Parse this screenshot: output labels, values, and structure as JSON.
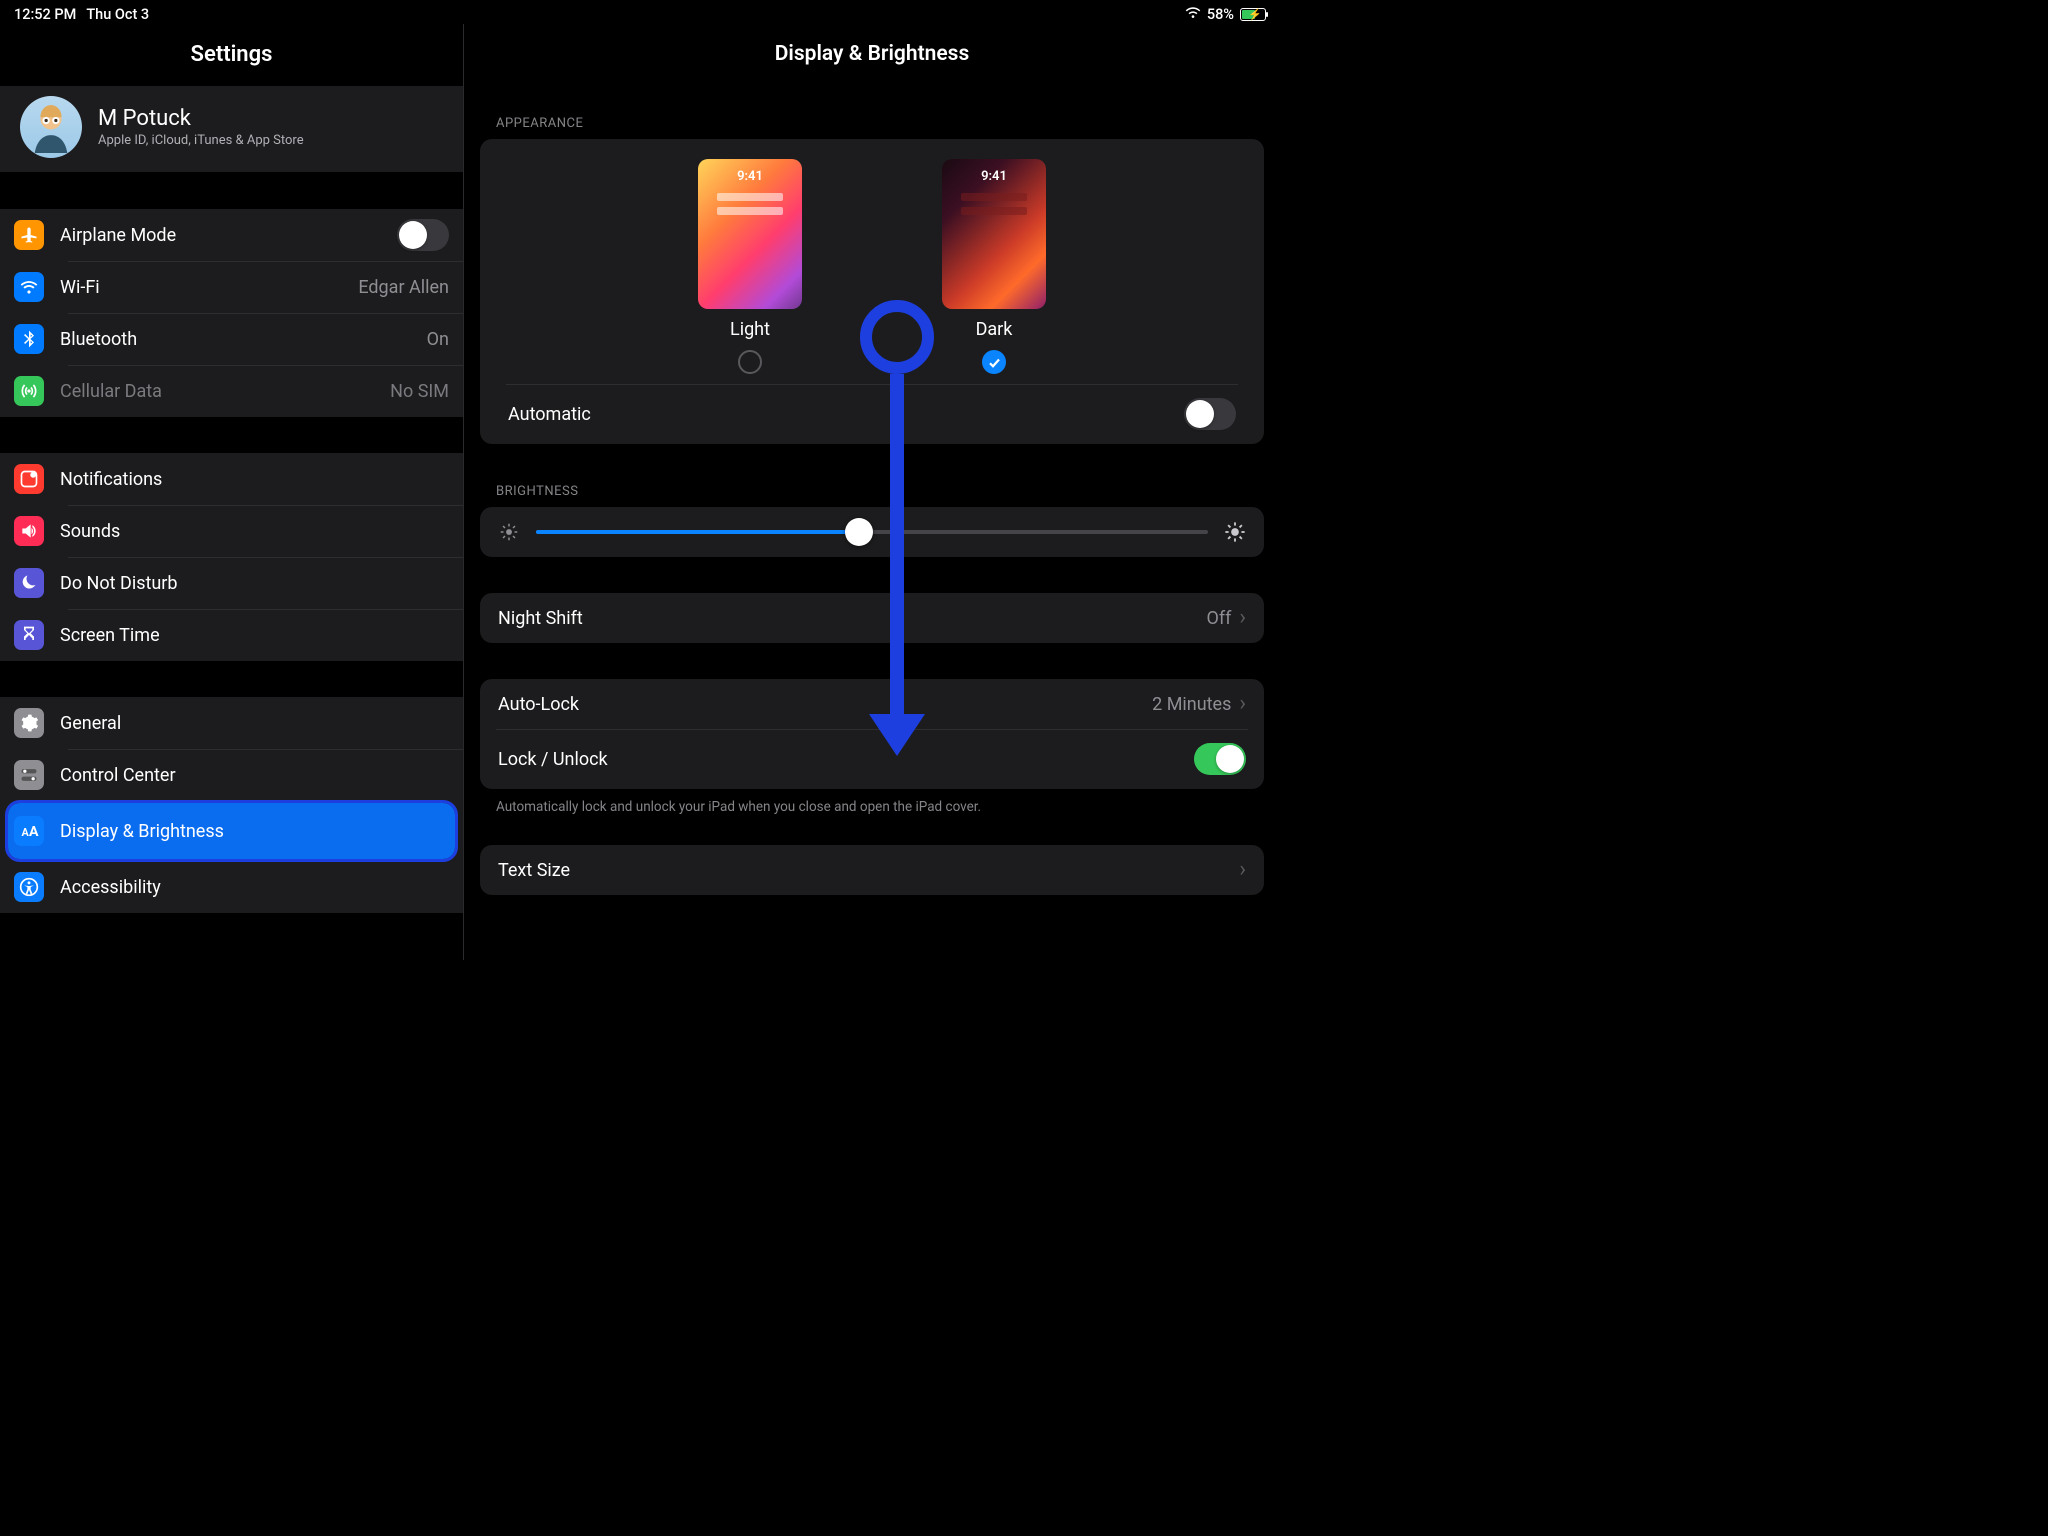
{
  "status": {
    "time": "12:52 PM",
    "date": "Thu Oct 3",
    "battery_pct": "58%"
  },
  "sidebar": {
    "title": "Settings",
    "profile": {
      "name": "M Potuck",
      "sub": "Apple ID, iCloud, iTunes & App Store"
    },
    "airplane": "Airplane Mode",
    "wifi": {
      "label": "Wi-Fi",
      "value": "Edgar Allen"
    },
    "bluetooth": {
      "label": "Bluetooth",
      "value": "On"
    },
    "cellular": {
      "label": "Cellular Data",
      "value": "No SIM"
    },
    "notifications": "Notifications",
    "sounds": "Sounds",
    "dnd": "Do Not Disturb",
    "screentime": "Screen Time",
    "general": "General",
    "controlcenter": "Control Center",
    "display": "Display & Brightness",
    "accessibility": "Accessibility"
  },
  "detail": {
    "title": "Display & Brightness",
    "appearance_header": "APPEARANCE",
    "theme_time": "9:41",
    "light": "Light",
    "dark": "Dark",
    "automatic": "Automatic",
    "brightness_header": "BRIGHTNESS",
    "nightshift": {
      "label": "Night Shift",
      "value": "Off"
    },
    "autolock": {
      "label": "Auto-Lock",
      "value": "2 Minutes"
    },
    "lockunlock": "Lock / Unlock",
    "lockunlock_note": "Automatically lock and unlock your iPad when you close and open the iPad cover.",
    "textsize": "Text Size"
  },
  "colors": {
    "orange": "#ff9500",
    "blue": "#007aff",
    "btblue": "#0a7cff",
    "green": "#35c759",
    "red": "#ff3b30",
    "purple": "#5856d6",
    "gray": "#8e8e93"
  }
}
